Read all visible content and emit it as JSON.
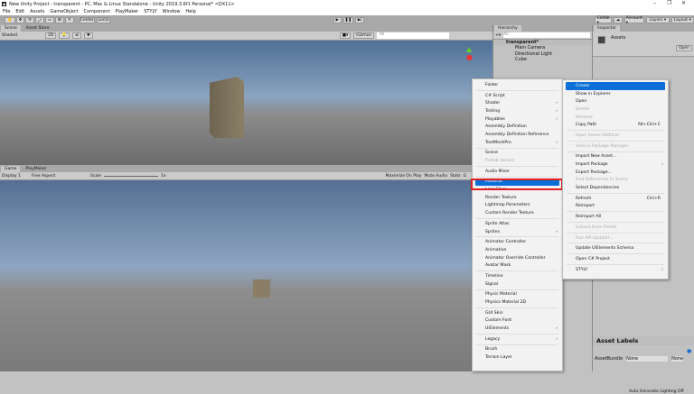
{
  "window": {
    "title": "New Unity Project - transparent - PC, Mac & Linux Standalone - Unity 2019.3.6f1 Personal* <DX11>",
    "controls": [
      "–",
      "❐",
      "✕"
    ]
  },
  "menubar": [
    "File",
    "Edit",
    "Assets",
    "GameObject",
    "Component",
    "PlayMaker",
    "STYLY",
    "Window",
    "Help"
  ],
  "toolbar": {
    "tools": [
      "✋",
      "✥",
      "⟳",
      "⤢",
      "▭",
      "⊞",
      "✕"
    ],
    "center": "Center",
    "local": "Local",
    "play": "▶",
    "pause": "❚❚",
    "step": "▶|",
    "collab": "Collab ▾",
    "account": "Account ▾",
    "layers": "Layers ▾",
    "layout": "Layout ▾"
  },
  "scene": {
    "tabs": [
      "Scene",
      "Asset Store"
    ],
    "shading": "Shaded",
    "mode_2d": "2D",
    "gizmos": "Gizmos",
    "search_placeholder": "All"
  },
  "game": {
    "tabs": [
      "Game",
      "PlayMaker"
    ],
    "display": "Display 1",
    "aspect": "Free Aspect",
    "scale_label": "Scale",
    "scale_value": "1x",
    "maximize": "Maximize On Play",
    "mute": "Mute Audio",
    "stats": "Stats",
    "gizmos": "G"
  },
  "hierarchy": {
    "title": "Hierarchy",
    "search_placeholder": "All",
    "scene": "transparent*",
    "items": [
      "Main Camera",
      "Directional Light",
      "Cube"
    ]
  },
  "inspector": {
    "title": "Inspector",
    "asset": "Assets",
    "open": "Open",
    "asset_labels": "Asset Labels",
    "assetbundle_label": "AssetBundle",
    "assetbundle_value": "None",
    "variant_value": "None",
    "status": "Auto Generate Lighting Off"
  },
  "create_menu": [
    {
      "label": "Folder"
    },
    {
      "sep": true
    },
    {
      "label": "C# Script"
    },
    {
      "label": "Shader",
      "sub": true
    },
    {
      "label": "Testing",
      "sub": true
    },
    {
      "label": "Playables",
      "sub": true
    },
    {
      "label": "Assembly Definition"
    },
    {
      "label": "Assembly Definition Reference"
    },
    {
      "label": "TextMeshPro",
      "sub": true
    },
    {
      "sep": true
    },
    {
      "label": "Scene"
    },
    {
      "label": "Prefab Variant",
      "disabled": true
    },
    {
      "sep": true
    },
    {
      "label": "Audio Mixer"
    },
    {
      "sep": true
    },
    {
      "label": "Material",
      "selected": true
    },
    {
      "label": "Lens Flare"
    },
    {
      "label": "Render Texture"
    },
    {
      "label": "Lightmap Parameters"
    },
    {
      "label": "Custom Render Texture"
    },
    {
      "sep": true
    },
    {
      "label": "Sprite Atlas"
    },
    {
      "label": "Sprites",
      "sub": true
    },
    {
      "sep": true
    },
    {
      "label": "Animator Controller"
    },
    {
      "label": "Animation"
    },
    {
      "label": "Animator Override Controller"
    },
    {
      "label": "Avatar Mask"
    },
    {
      "sep": true
    },
    {
      "label": "Timeline"
    },
    {
      "label": "Signal"
    },
    {
      "sep": true
    },
    {
      "label": "Physic Material"
    },
    {
      "label": "Physics Material 2D"
    },
    {
      "sep": true
    },
    {
      "label": "GUI Skin"
    },
    {
      "label": "Custom Font"
    },
    {
      "label": "UIElements",
      "sub": true
    },
    {
      "sep": true
    },
    {
      "label": "Legacy",
      "sub": true
    },
    {
      "sep": true
    },
    {
      "label": "Brush"
    },
    {
      "label": "Terrain Layer"
    }
  ],
  "assets_menu": [
    {
      "label": "Create",
      "selected": true
    },
    {
      "label": "Show in Explorer"
    },
    {
      "label": "Open"
    },
    {
      "label": "Delete",
      "disabled": true
    },
    {
      "label": "Rename",
      "disabled": true
    },
    {
      "label": "Copy Path",
      "shortcut": "Alt+Ctrl+C"
    },
    {
      "sep": true
    },
    {
      "label": "Open Scene Additive",
      "disabled": true
    },
    {
      "sep": true
    },
    {
      "label": "View in Package Manager",
      "disabled": true
    },
    {
      "sep": true
    },
    {
      "label": "Import New Asset..."
    },
    {
      "label": "Import Package",
      "sub": true
    },
    {
      "label": "Export Package..."
    },
    {
      "label": "Find References In Scene",
      "disabled": true
    },
    {
      "label": "Select Dependencies"
    },
    {
      "sep": true
    },
    {
      "label": "Refresh",
      "shortcut": "Ctrl+R"
    },
    {
      "label": "Reimport"
    },
    {
      "sep": true
    },
    {
      "label": "Reimport All"
    },
    {
      "sep": true
    },
    {
      "label": "Extract From Prefab",
      "disabled": true
    },
    {
      "sep": true
    },
    {
      "label": "Run API Updater...",
      "disabled": true
    },
    {
      "sep": true
    },
    {
      "label": "Update UIElements Schema"
    },
    {
      "sep": true
    },
    {
      "label": "Open C# Project"
    },
    {
      "sep": true
    },
    {
      "label": "STYLY",
      "sub": true
    }
  ],
  "colors": {
    "highlight": "#0a6fd6",
    "annotation": "#e02020"
  }
}
